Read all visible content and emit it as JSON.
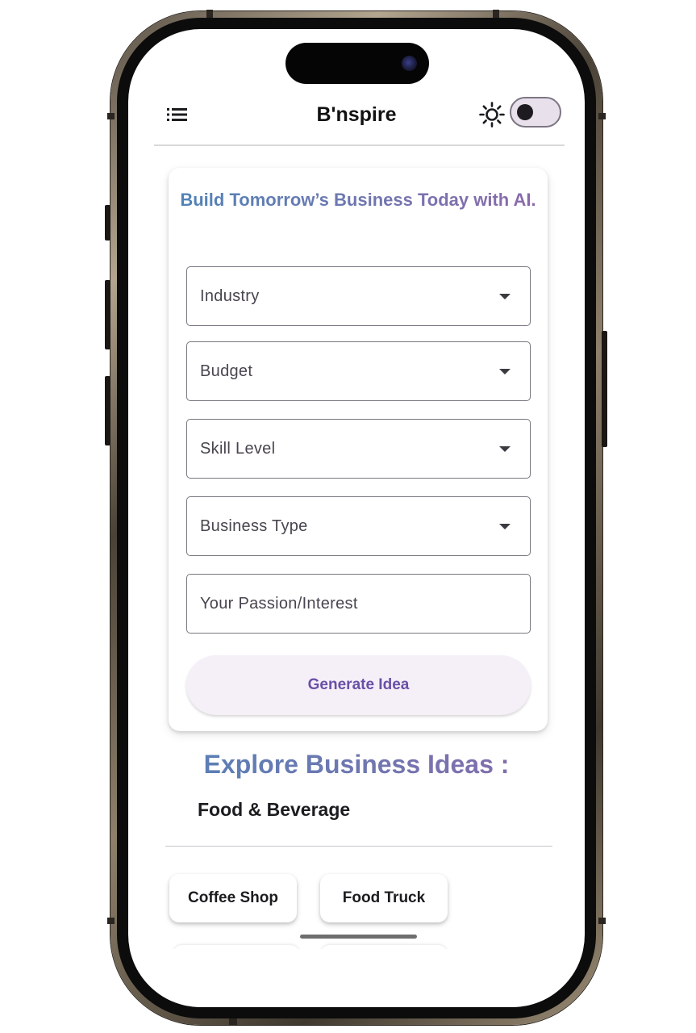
{
  "app": {
    "title": "B'nspire",
    "menu_icon": "menu-list-icon",
    "theme_icon": "sun-icon",
    "theme_toggle_on": false
  },
  "form": {
    "heading": "Build Tomorrow’s Business Today with AI.",
    "fields": [
      {
        "label": "Industry",
        "type": "dropdown"
      },
      {
        "label": "Budget",
        "type": "dropdown"
      },
      {
        "label": "Skill Level",
        "type": "dropdown"
      },
      {
        "label": "Business Type",
        "type": "dropdown"
      },
      {
        "label": "Your Passion/Interest",
        "type": "text"
      }
    ],
    "submit_label": "Generate Idea"
  },
  "explore": {
    "heading": "Explore Business Ideas :",
    "category": "Food & Beverage",
    "ideas": [
      "Coffee Shop",
      "Food Truck"
    ]
  },
  "colors": {
    "gradient_start": "#5283b7",
    "gradient_end": "#8b6aaa",
    "button_text": "#6a4fa6",
    "button_bg": "#f5eff8"
  }
}
